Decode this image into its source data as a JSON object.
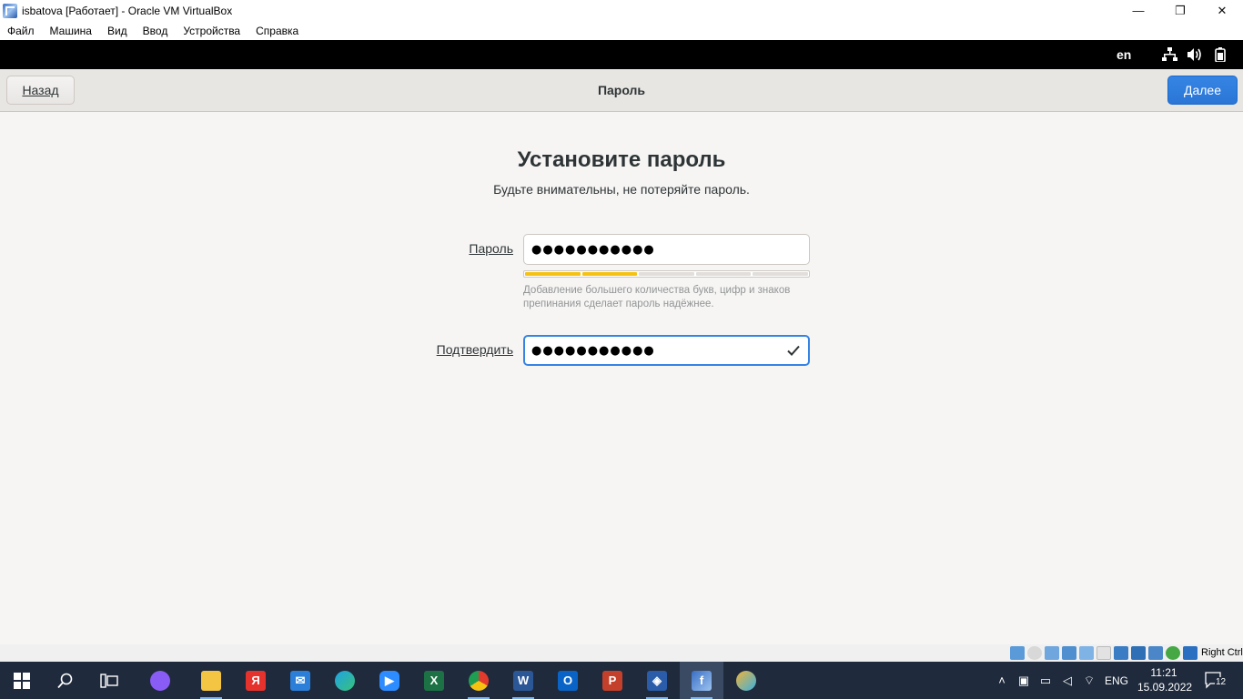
{
  "window": {
    "title": "isbatova [Работает] - Oracle VM VirtualBox",
    "minimize_glyph": "—",
    "maximize_glyph": "❐",
    "close_glyph": "✕"
  },
  "menu": [
    "Файл",
    "Машина",
    "Вид",
    "Ввод",
    "Устройства",
    "Справка"
  ],
  "guest_topbar": {
    "language": "en",
    "icons": [
      "network-icon",
      "volume-icon",
      "battery-icon"
    ]
  },
  "headerbar": {
    "back_label": "Назад",
    "title": "Пароль",
    "next_label": "Далее"
  },
  "page": {
    "heading": "Установите пароль",
    "subtitle": "Будьте внимательны, не потеряйте пароль."
  },
  "form": {
    "password_label": "Пароль",
    "password_value": "●●●●●●●●●●●",
    "strength_level": 0.4,
    "hint": "Добавление большего количества букв, цифр и знаков препинания сделает пароль надёжнее.",
    "confirm_label": "Подтвердить",
    "confirm_value": "●●●●●●●●●●●"
  },
  "vb_status": {
    "host_key": "Right Ctrl"
  },
  "taskbar": {
    "apps": [
      "start",
      "search",
      "task-view",
      "alice",
      "file-explorer",
      "yandex-browser",
      "mail",
      "edge",
      "zoom",
      "excel",
      "chrome",
      "word",
      "outlook",
      "powerpoint",
      "virtualbox",
      "virtualbox-vm",
      "paint"
    ],
    "tray_lang": "ENG",
    "time": "11:21",
    "date": "15.09.2022",
    "notification_count": "12"
  },
  "colors": {
    "accent": "#3584e4",
    "strength": "#f5c211",
    "taskbar": "#1f2a3c"
  }
}
